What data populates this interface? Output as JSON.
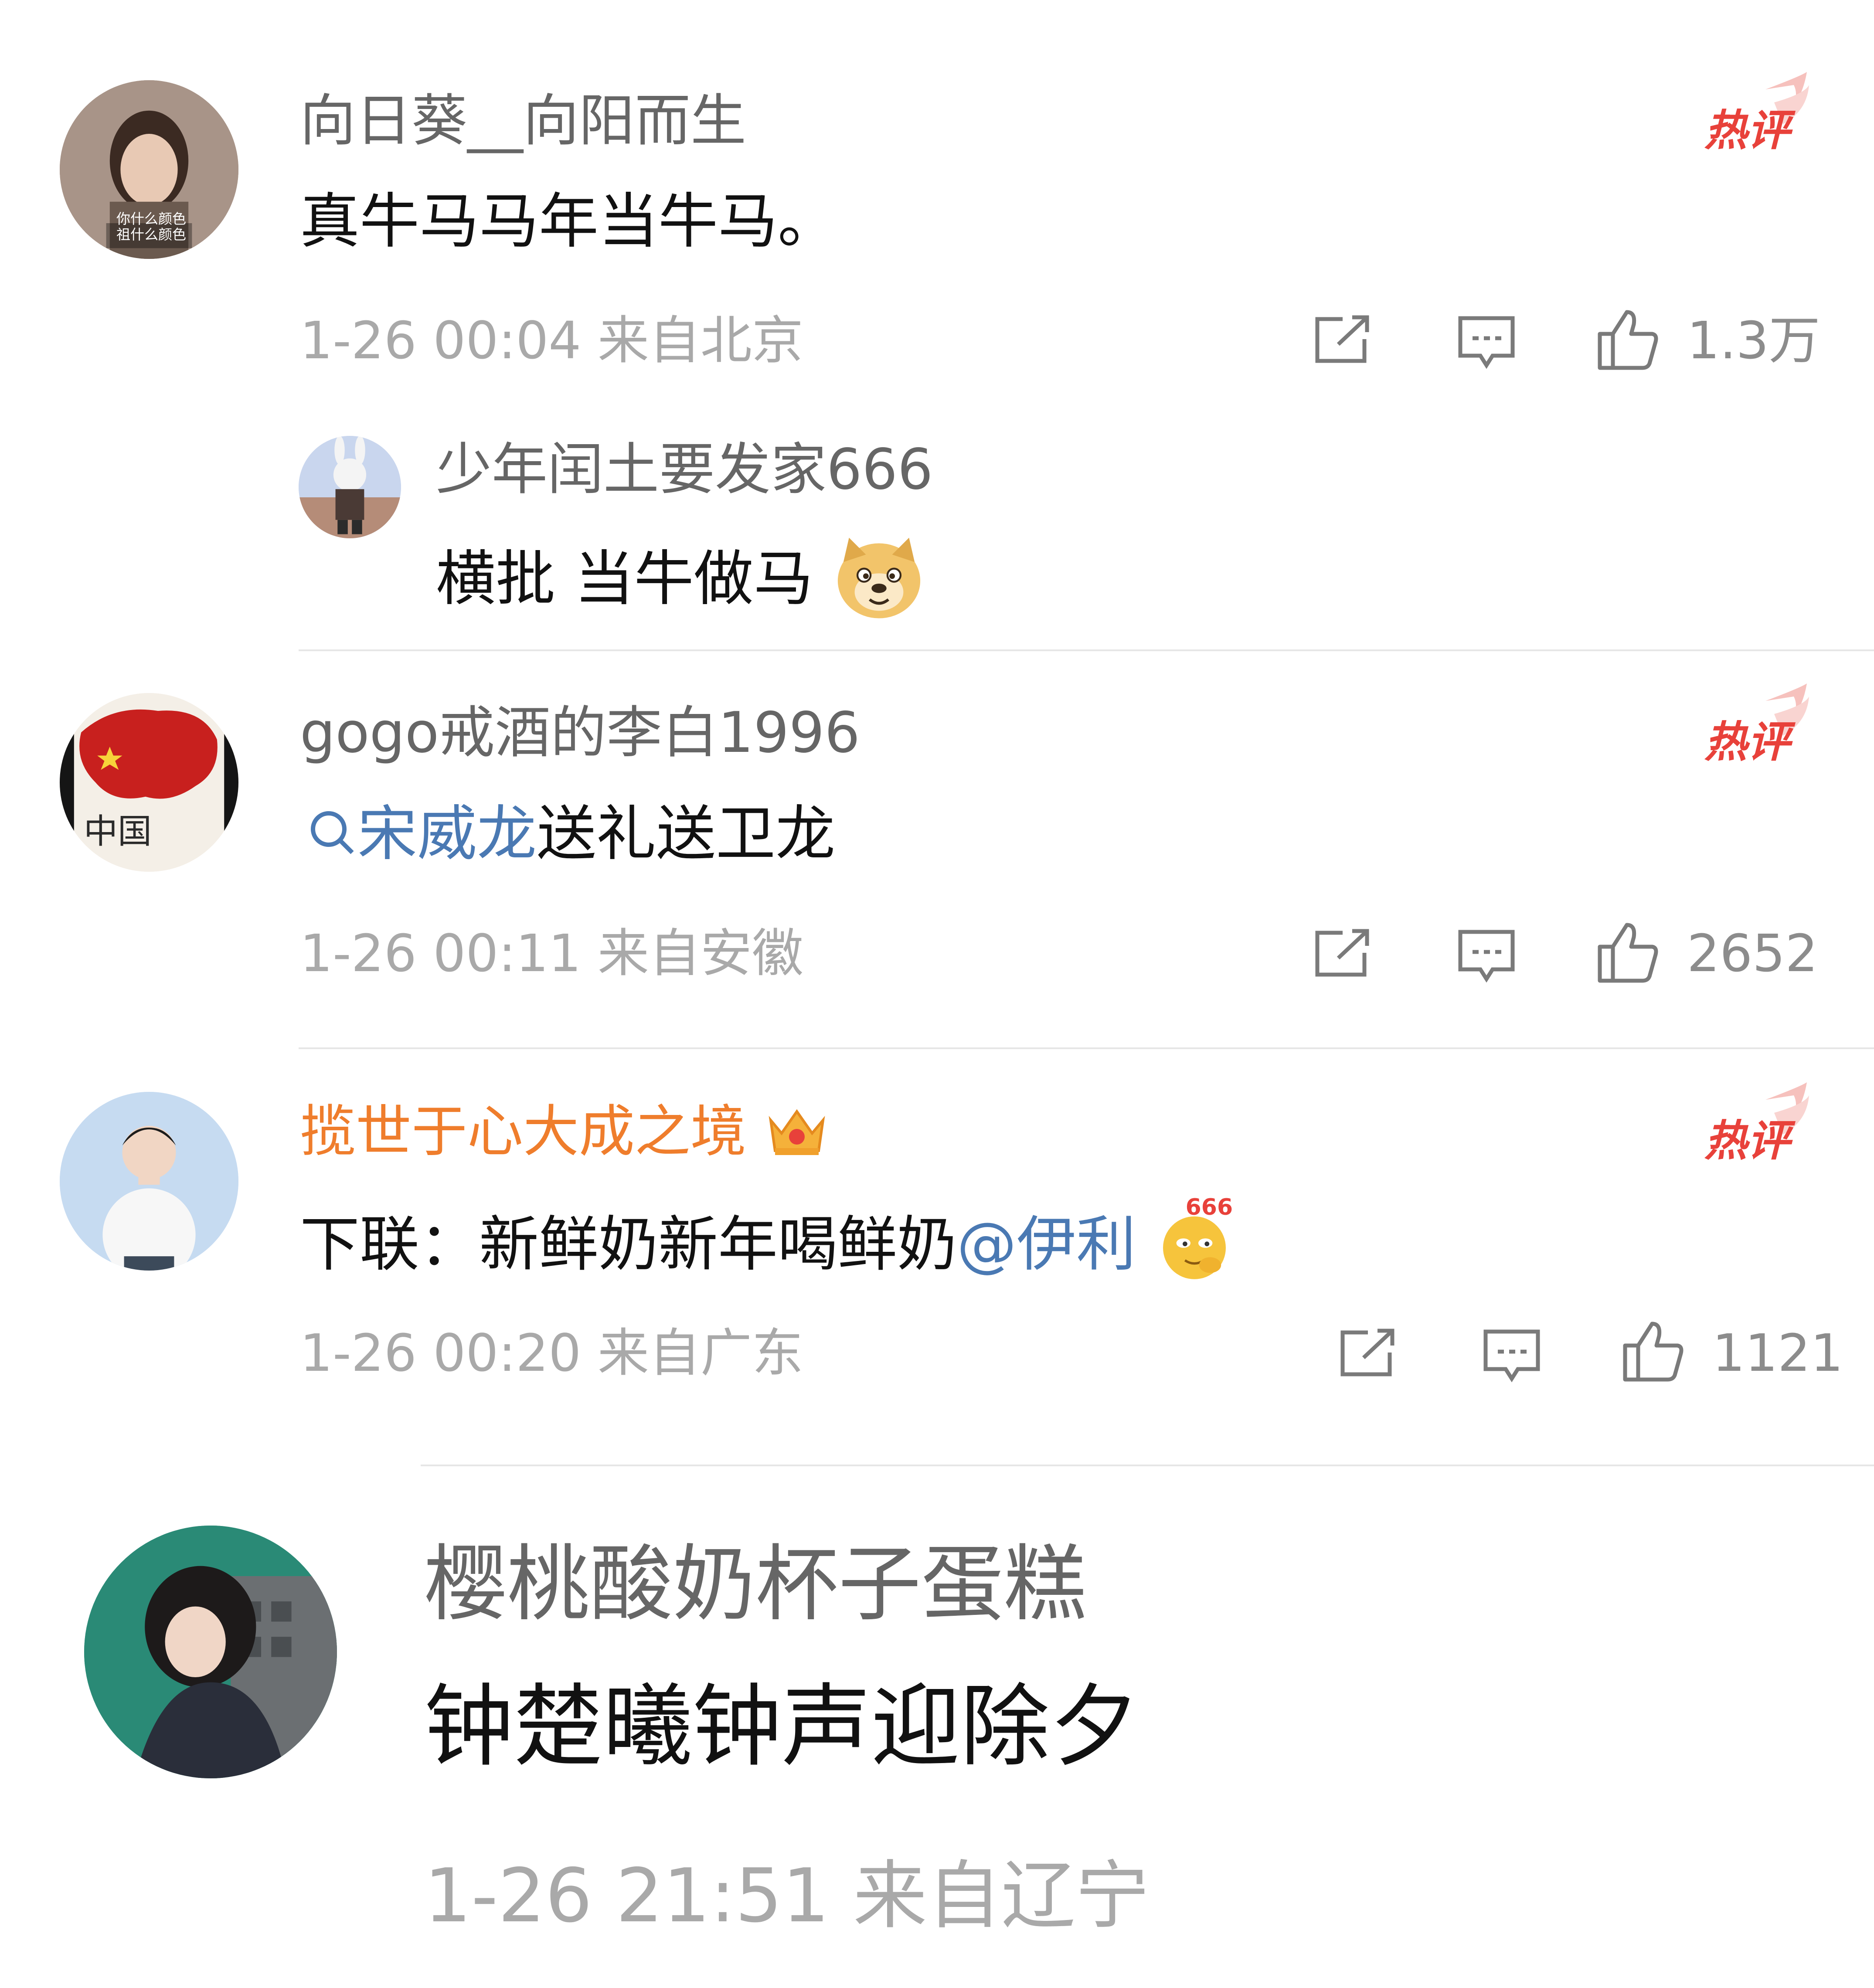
{
  "colors": {
    "hot_red": "#e8413a",
    "vip_orange": "#ef7d2c",
    "link_blue": "#4a79b3",
    "meta_gray": "#a9a9a9"
  },
  "hot_badge_label": "热评",
  "comments": [
    {
      "user": "向日葵__向阳而生",
      "avatar_caption_line1": "你什么颜色",
      "avatar_caption_line2": "祖什么颜色",
      "text": "真牛马马年当牛马。",
      "time": "1-26 00:04",
      "location": "来自北京",
      "likes": "1.3万",
      "hot": true,
      "reply": {
        "user": "少年闰土要发家666",
        "text": "横批 当牛做马",
        "emoji": "doge-emoji"
      }
    },
    {
      "user": "gogo戒酒的李白1996",
      "avatar_caption": "中国",
      "search_icon": "search-icon",
      "text_link": "宋威龙",
      "text_rest": "送礼送卫龙",
      "time": "1-26 00:11",
      "location": "来自安徽",
      "likes": "2652",
      "hot": true
    },
    {
      "user": "揽世于心大成之境",
      "badge_icon": "crown-badge-icon",
      "text": "下联：新鲜奶新年喝鲜奶",
      "mention": "@伊利",
      "emoji": "666-emoji",
      "emoji_label": "666",
      "time": "1-26 00:20",
      "location": "来自广东",
      "likes": "1121",
      "hot": true
    },
    {
      "user": "樱桃酸奶杯子蛋糕",
      "text": "钟楚曦钟声迎除夕",
      "time": "1-26 21:51",
      "location": "来自辽宁"
    }
  ]
}
